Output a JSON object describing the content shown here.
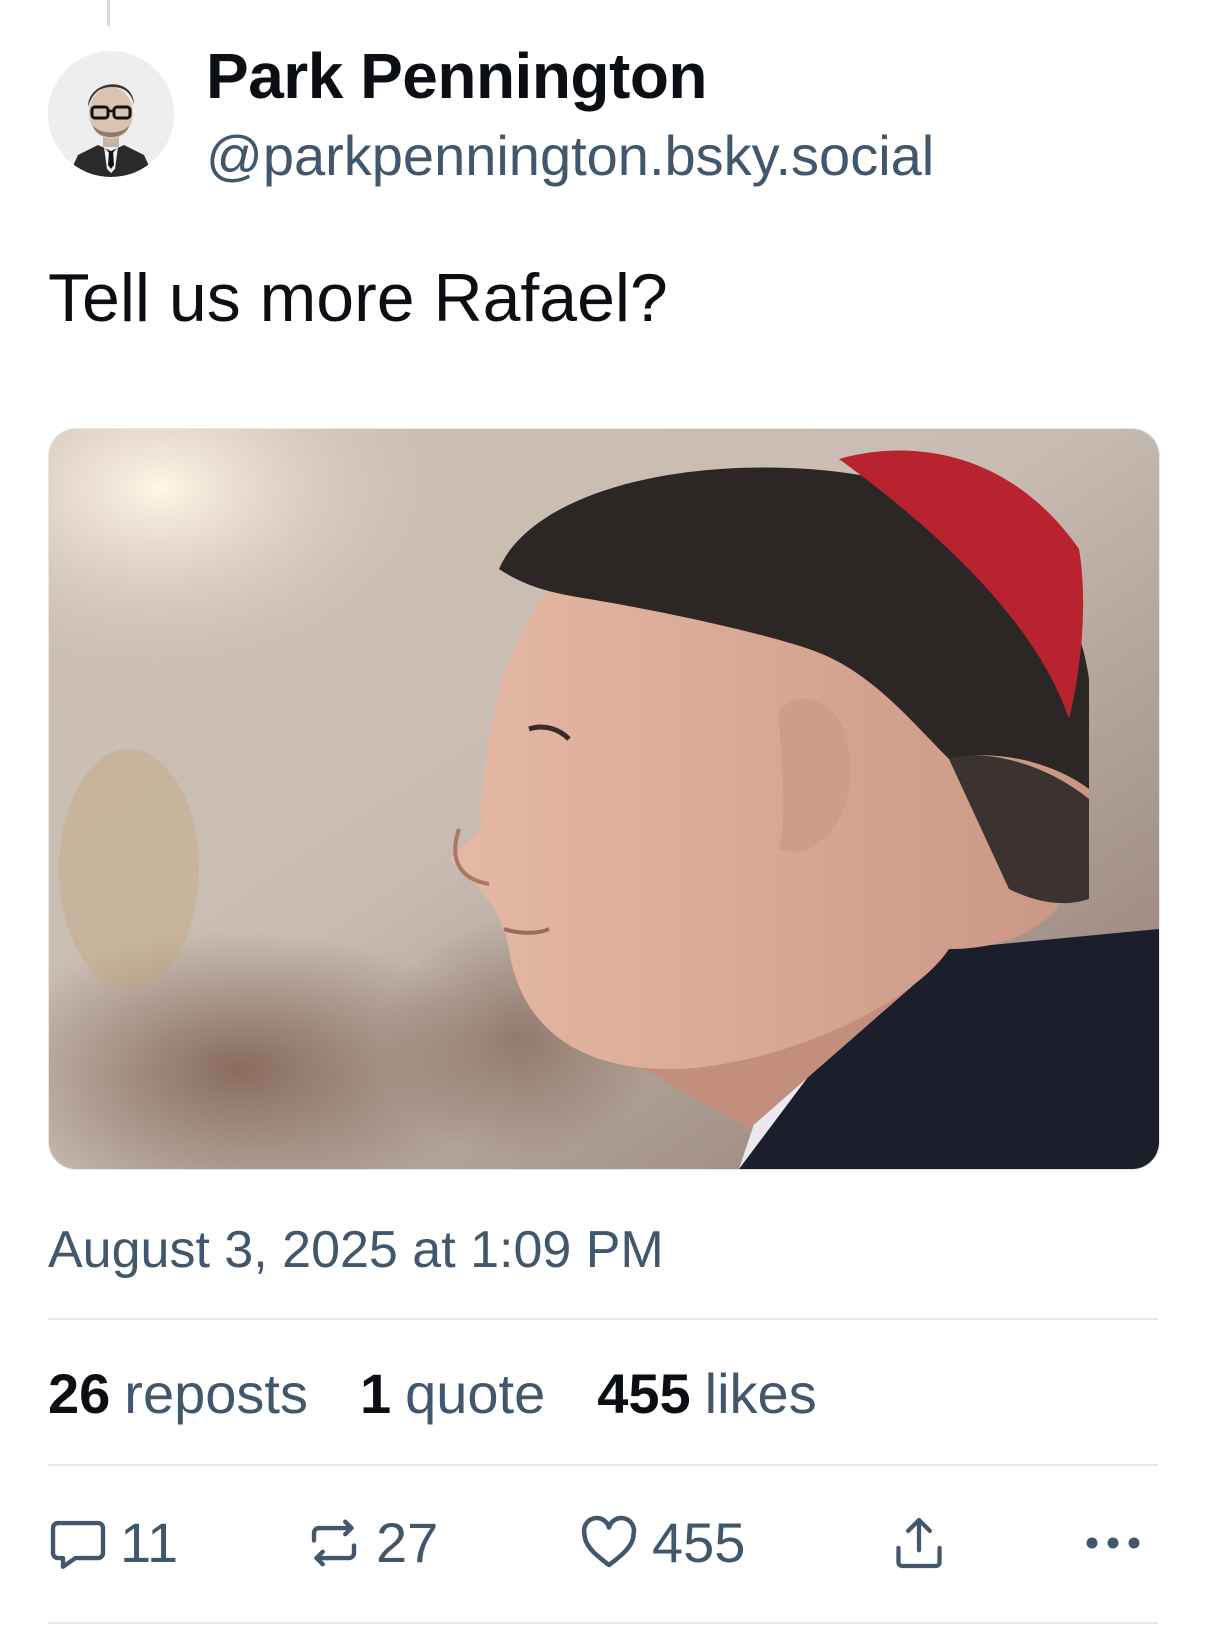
{
  "post": {
    "author": {
      "display_name": "Park Pennington",
      "handle": "@parkpennington.bsky.social"
    },
    "text": "Tell us more Rafael?",
    "timestamp": "August 3, 2025 at 1:09 PM",
    "stats": {
      "reposts_count": "26",
      "reposts_label": "reposts",
      "quotes_count": "1",
      "quotes_label": "quote",
      "likes_count": "455",
      "likes_label": "likes"
    },
    "actions": {
      "reply_count": "11",
      "repost_count": "27",
      "like_count": "455"
    }
  },
  "icons": {
    "reply": "speech-bubble-icon",
    "repost": "repost-arrows-icon",
    "like": "heart-icon",
    "share": "share-upload-icon",
    "more": "ellipsis-icon"
  },
  "colors": {
    "text_primary": "#0b0f14",
    "text_secondary": "#42576c",
    "divider": "#e3e8ed",
    "background": "#ffffff"
  }
}
